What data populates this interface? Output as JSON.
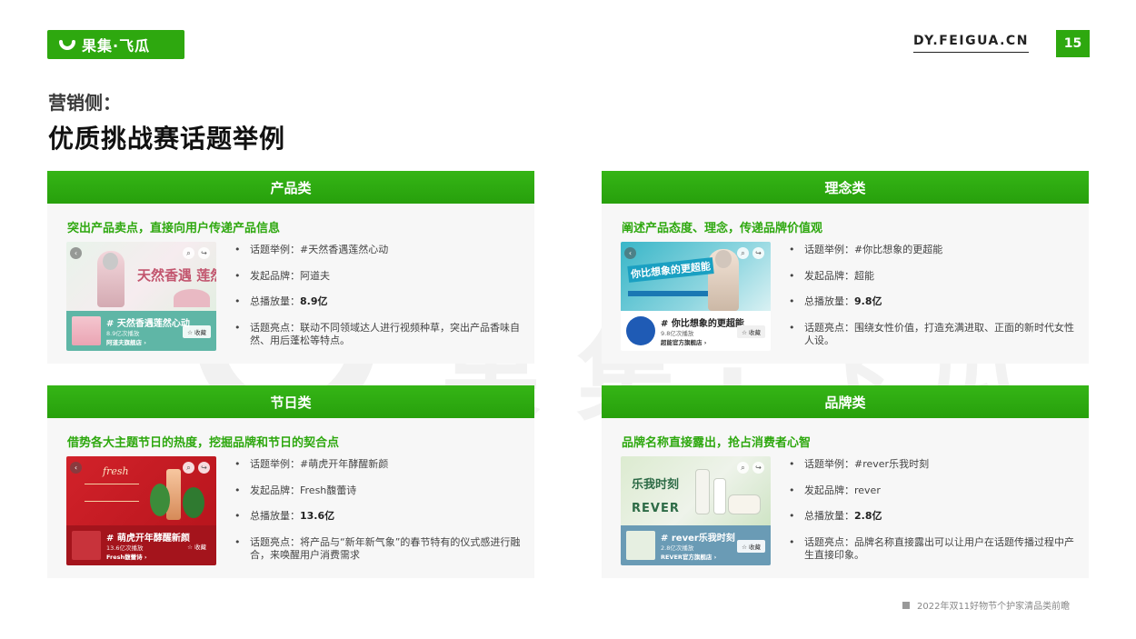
{
  "header": {
    "logo_text": "果集·飞瓜",
    "site_url": "DY.FEIGUA.CN",
    "page_number": "15"
  },
  "subtitle": "营销侧：",
  "title": "优质挑战赛话题举例",
  "watermark": "果集·飞瓜",
  "fields": {
    "topic": "话题举例：",
    "brand": "发起品牌：",
    "plays": "总播放量：",
    "highlight": "话题亮点："
  },
  "panels": [
    {
      "category": "产品类",
      "description": "突出产品卖点，直接向用户传递产品信息",
      "topic": "#天然香遇莲然心动",
      "brand": "阿道夫",
      "plays": "8.9亿",
      "highlight": "联动不同领域达人进行视频种草，突出产品香味自然、用后蓬松等特点。",
      "thumb": {
        "overlay_text": "天然香遇 莲然心动",
        "tag": "# 天然香遇莲然心动",
        "count": "8.9亿次播放",
        "brand": "阿道夫旗舰店 ›",
        "fav": "☆ 收藏"
      }
    },
    {
      "category": "理念类",
      "description": "阐述产品态度、理念，传递品牌价值观",
      "topic": "#你比想象的更超能",
      "brand": "超能",
      "plays": "9.8亿",
      "highlight": "围绕女性价值，打造充满进取、正面的新时代女性人设。",
      "thumb": {
        "overlay_text": "你比想象的更超能",
        "tag": "# 你比想象的更超能",
        "count": "9.8亿次播放",
        "brand": "超能官方旗舰店 ›",
        "fav": "☆ 收藏"
      }
    },
    {
      "category": "节日类",
      "description": "借势各大主题节日的热度，挖掘品牌和节日的契合点",
      "topic": "#萌虎开年酵醒新颜",
      "brand": "Fresh馥蕾诗",
      "plays": "13.6亿",
      "highlight": "将产品与“新年新气象”的春节特有的仪式感进行融合，来唤醒用户消费需求",
      "thumb": {
        "overlay_text": "fresh",
        "tag": "# 萌虎开年酵醒新颜",
        "count": "13.6亿次播放",
        "brand": "Fresh馥蕾诗 ›",
        "fav": "☆ 收藏"
      }
    },
    {
      "category": "品牌类",
      "description": "品牌名称直接露出，抢占消费者心智",
      "topic": "#rever乐我时刻",
      "brand": "rever",
      "plays": "2.8亿",
      "highlight": "品牌名称直接露出可以让用户在话题传播过程中产生直接印象。",
      "thumb": {
        "overlay_text": "乐我时刻",
        "overlay_sub": "REVER",
        "tag": "# rever乐我时刻",
        "count": "2.8亿次播放",
        "brand": "REVER官方旗舰店 ›",
        "fav": "☆ 收藏"
      }
    }
  ],
  "footer": "2022年双11好物节个护家清品类前瞻",
  "colors": {
    "accent": "#2ea80f",
    "panel_bg": "#f7f7f7"
  }
}
